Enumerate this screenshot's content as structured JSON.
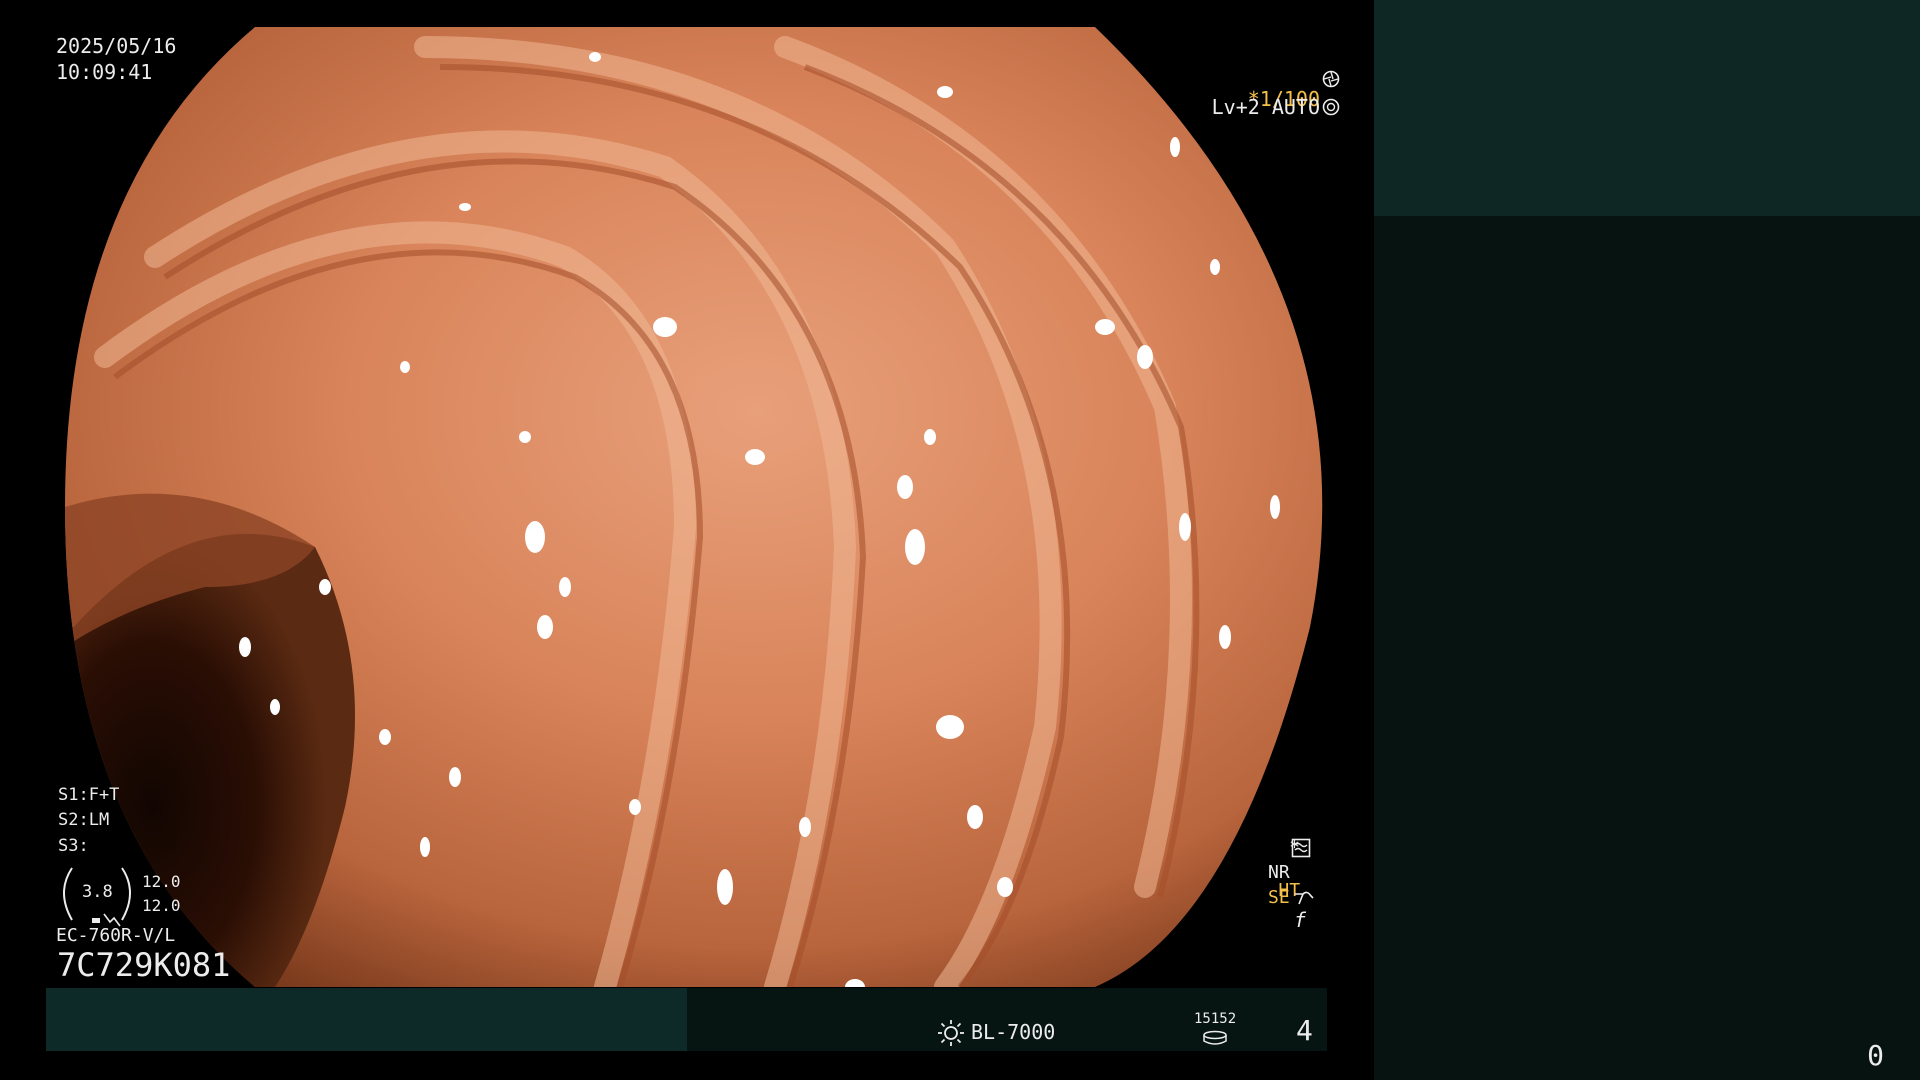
{
  "datetime": {
    "date": "2025/05/16",
    "time": "10:09:41"
  },
  "exposure": {
    "shutter": "*1/100",
    "level": "Lv+2 AUTO"
  },
  "settings": {
    "s1": "S1:F+T",
    "s2": "S2:LM",
    "s3": "S3:"
  },
  "zoom": {
    "value": "3.8",
    "max_top": "12.0",
    "max_bottom": "12.0"
  },
  "scope": {
    "model": "EC-760R-V/L",
    "serial": "7C729K081"
  },
  "indicators": {
    "star": "*",
    "ht": "HT",
    "nr": "NR",
    "se": "SE",
    "f": "f",
    "colors": {
      "yellow": "#f4c04a",
      "white": "#ececec"
    }
  },
  "bottom_bar": {
    "light_source": "BL-7000",
    "counter": "15152",
    "image_count": "4"
  },
  "side_panel": {
    "count": "0"
  },
  "colors": {
    "background": "#000000",
    "panel_top": "#0f2724",
    "panel_bottom": "#071311",
    "bar_left": "#0e2a28",
    "bar_right": "#061512"
  }
}
